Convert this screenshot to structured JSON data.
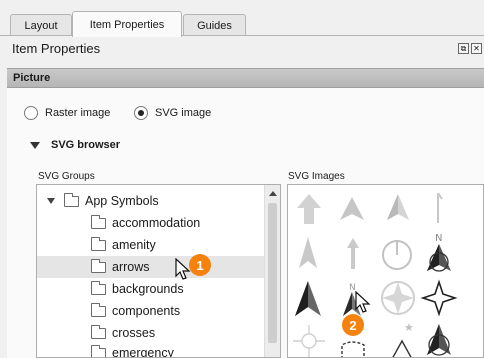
{
  "tabs": [
    {
      "label": "Layout",
      "active": false
    },
    {
      "label": "Item Properties",
      "active": true
    },
    {
      "label": "Guides",
      "active": false
    }
  ],
  "panel": {
    "title": "Item Properties",
    "float_icon": "float-window-icon",
    "close_icon": "close-icon"
  },
  "section": {
    "title": "Picture"
  },
  "source": {
    "raster_label": "Raster image",
    "svg_label": "SVG image",
    "selected": "SVG image"
  },
  "svg_browser": {
    "title": "SVG browser",
    "groups_label": "SVG Groups",
    "images_label": "SVG Images",
    "groups": {
      "root": "App Symbols",
      "children": [
        "accommodation",
        "amenity",
        "arrows",
        "backgrounds",
        "components",
        "crosses",
        "emergency"
      ],
      "hovered": "arrows"
    },
    "images": [
      "arrow-up-thick-icon",
      "arrow-point-icon",
      "arrow-half-point-icon",
      "arrow-thin-hook-icon",
      "arrow-slim-icon",
      "arrow-thin-up-icon",
      "north-circle-icon",
      "north-arrow-star-icon",
      "north-arrow-dark-icon",
      "north-n-arrow-icon",
      "compass-star-icon",
      "four-point-star-icon",
      "compass-cross-icon",
      "north-box-icon",
      "north-star-icon",
      "north-arrow-ornate-icon"
    ]
  },
  "callouts": [
    {
      "label": "1"
    },
    {
      "label": "2"
    }
  ],
  "colors": {
    "accent": "#f5820d",
    "section_bar": "#bdbdbd"
  }
}
